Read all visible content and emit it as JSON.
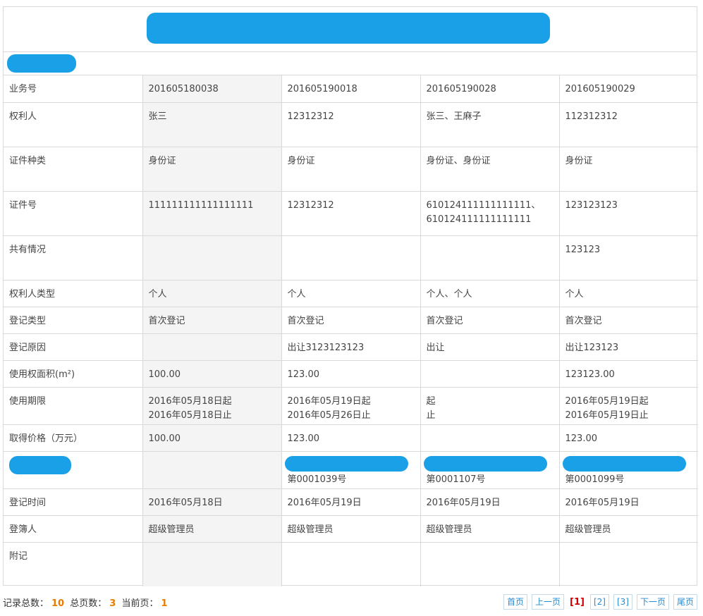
{
  "columns": [
    "201605180038",
    "201605190018",
    "201605190028",
    "201605190029"
  ],
  "rows": [
    {
      "label": "业务号",
      "cells": [
        "201605180038",
        "201605190018",
        "201605190028",
        "201605190029"
      ],
      "h": 38
    },
    {
      "label": "权利人",
      "cells": [
        "张三",
        "12312312",
        "张三、王麻子",
        "112312312"
      ],
      "h": 63
    },
    {
      "label": "证件种类",
      "cells": [
        "身份证",
        "身份证",
        "身份证、身份证",
        "身份证"
      ],
      "h": 63
    },
    {
      "label": "证件号",
      "cells": [
        "111111111111111111",
        "12312312",
        "610124111111111111、\n610124111111111111",
        "123123123"
      ],
      "h": 63
    },
    {
      "label": "共有情况",
      "cells": [
        "",
        "",
        "",
        "123123"
      ],
      "h": 63
    },
    {
      "label": "权利人类型",
      "cells": [
        "个人",
        "个人",
        "个人、个人",
        "个人"
      ],
      "h": 38
    },
    {
      "label": "登记类型",
      "cells": [
        "首次登记",
        "首次登记",
        "首次登记",
        "首次登记"
      ],
      "h": 38
    },
    {
      "label": "登记原因",
      "cells": [
        "",
        "出让3123123123",
        "出让",
        "出让123123"
      ],
      "h": 38
    },
    {
      "label": "使用权面积(m²)",
      "cells": [
        "100.00",
        "123.00",
        "",
        "123123.00"
      ],
      "h": 38
    },
    {
      "label": "使用期限",
      "cells": [
        "2016年05月18日起\n2016年05月18日止",
        "2016年05月19日起\n2016年05月26日止",
        "起\n止",
        "2016年05月19日起\n2016年05月19日止"
      ],
      "h": 53
    },
    {
      "label": "取得价格（万元）",
      "cells": [
        "100.00",
        "123.00",
        "",
        "123.00"
      ],
      "h": 38
    },
    {
      "label": "",
      "cells": [
        "",
        "\n第0001039号",
        "\n第0001107号",
        "\n第0001099号"
      ],
      "h": 53,
      "redacted": true
    },
    {
      "label": "登记时间",
      "cells": [
        "2016年05月18日",
        "2016年05月19日",
        "2016年05月19日",
        "2016年05月19日"
      ],
      "h": 38
    },
    {
      "label": "登簿人",
      "cells": [
        "超级管理员",
        "超级管理员",
        "超级管理员",
        "超级管理员"
      ],
      "h": 38
    },
    {
      "label": "附记",
      "cells": [
        "",
        "",
        "",
        ""
      ],
      "h": 63
    }
  ],
  "footer": {
    "total_label": "记录总数：",
    "total": "10",
    "pages_label": "总页数：",
    "pages": "3",
    "current_label": "当前页：",
    "current": "1"
  },
  "pager": {
    "first": "首页",
    "prev": "上一页",
    "current": "[1]",
    "p2": "[2]",
    "p3": "[3]",
    "next": "下一页",
    "last": "尾页"
  },
  "colors": {
    "border": "#d9d9d9",
    "redaction": "#1aa0e6",
    "accent": "#e87b00",
    "link": "#2a8bd0"
  }
}
